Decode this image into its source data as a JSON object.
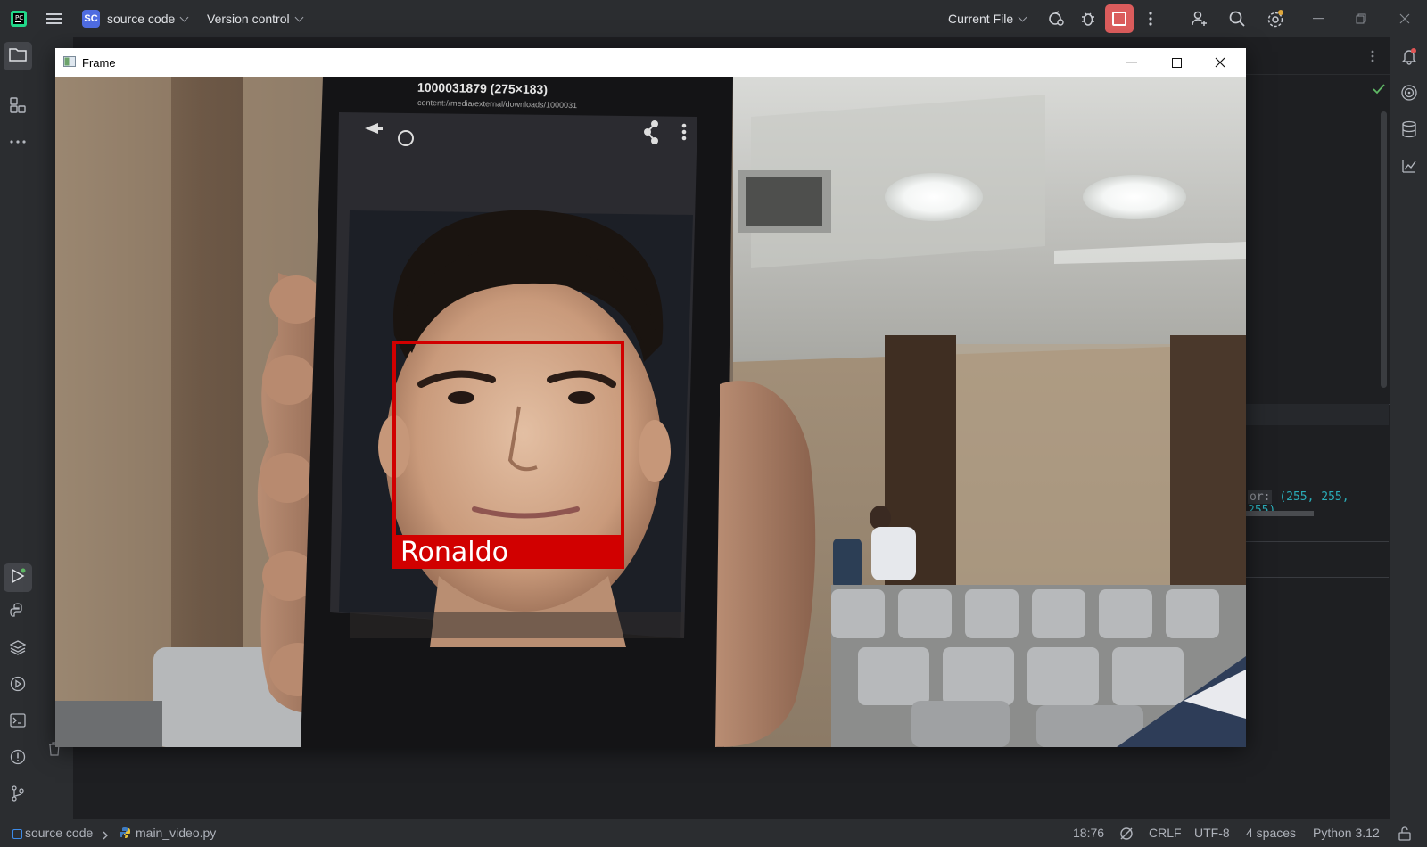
{
  "topbar": {
    "project_badge": "SC",
    "project_name": "source code",
    "vcs_label": "Version control",
    "run_config": "Current File"
  },
  "frame_window": {
    "title": "Frame"
  },
  "camera": {
    "phone_title": "1000031879 (275×183)",
    "phone_path": "content://media/external/downloads/1000031",
    "detection_label": "Ronaldo",
    "box_color": "#d10000"
  },
  "editor": {
    "code_prefix": "or:",
    "code_value": "(255, 255, 255),"
  },
  "statusbar": {
    "project": "source code",
    "file": "main_video.py",
    "position": "18:76",
    "line_ending": "CRLF",
    "encoding": "UTF-8",
    "indent": "4 spaces",
    "interpreter": "Python 3.12"
  },
  "icons": [
    "app-logo-icon",
    "hamburger-icon",
    "build-icon",
    "debug-icon",
    "stop-icon",
    "more-icon",
    "add-user-icon",
    "search-icon",
    "settings-icon",
    "minimize-icon",
    "restore-icon",
    "close-icon",
    "folder-icon",
    "structure-icon",
    "run-icon",
    "python-console-icon",
    "layers-icon",
    "services-icon",
    "terminal-icon",
    "problems-icon",
    "git-icon",
    "notifications-icon",
    "ai-icon",
    "database-icon",
    "sciview-icon",
    "check-icon"
  ]
}
